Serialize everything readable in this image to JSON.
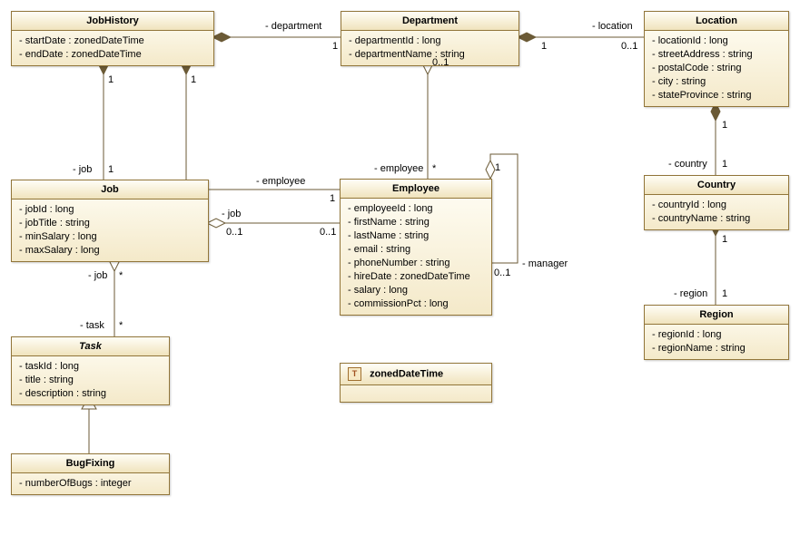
{
  "classes": {
    "JobHistory": {
      "name": "JobHistory",
      "attrs": [
        "- startDate : zonedDateTime",
        "- endDate : zonedDateTime"
      ]
    },
    "Department": {
      "name": "Department",
      "attrs": [
        "- departmentId : long",
        "- departmentName : string"
      ]
    },
    "Location": {
      "name": "Location",
      "attrs": [
        "- locationId : long",
        "- streetAddress : string",
        "- postalCode : string",
        "- city : string",
        "- stateProvince : string"
      ]
    },
    "Job": {
      "name": "Job",
      "attrs": [
        "- jobId : long",
        "- jobTitle : string",
        "- minSalary : long",
        "- maxSalary : long"
      ]
    },
    "Employee": {
      "name": "Employee",
      "attrs": [
        "- employeeId : long",
        "- firstName : string",
        "- lastName : string",
        "- email : string",
        "- phoneNumber : string",
        "- hireDate : zonedDateTime",
        "- salary : long",
        "- commissionPct : long"
      ]
    },
    "Country": {
      "name": "Country",
      "attrs": [
        "- countryId : long",
        "- countryName : string"
      ]
    },
    "Task": {
      "name": "Task",
      "attrs": [
        "- taskId : long",
        "- title : string",
        "- description : string"
      ]
    },
    "Region": {
      "name": "Region",
      "attrs": [
        "- regionId : long",
        "- regionName : string"
      ]
    },
    "BugFixing": {
      "name": "BugFixing",
      "attrs": [
        "- numberOfBugs : integer"
      ]
    },
    "zonedDateTime": {
      "name": "zonedDateTime"
    }
  },
  "labels": {
    "department": "- department",
    "location": "- location",
    "job": "- job",
    "employee": "- employee",
    "country": "- country",
    "manager": "- manager",
    "region": "- region",
    "task": "- task"
  },
  "mult": {
    "one": "1",
    "zeroOne": "0..1",
    "many": "*"
  },
  "datatypeIcon": "T"
}
